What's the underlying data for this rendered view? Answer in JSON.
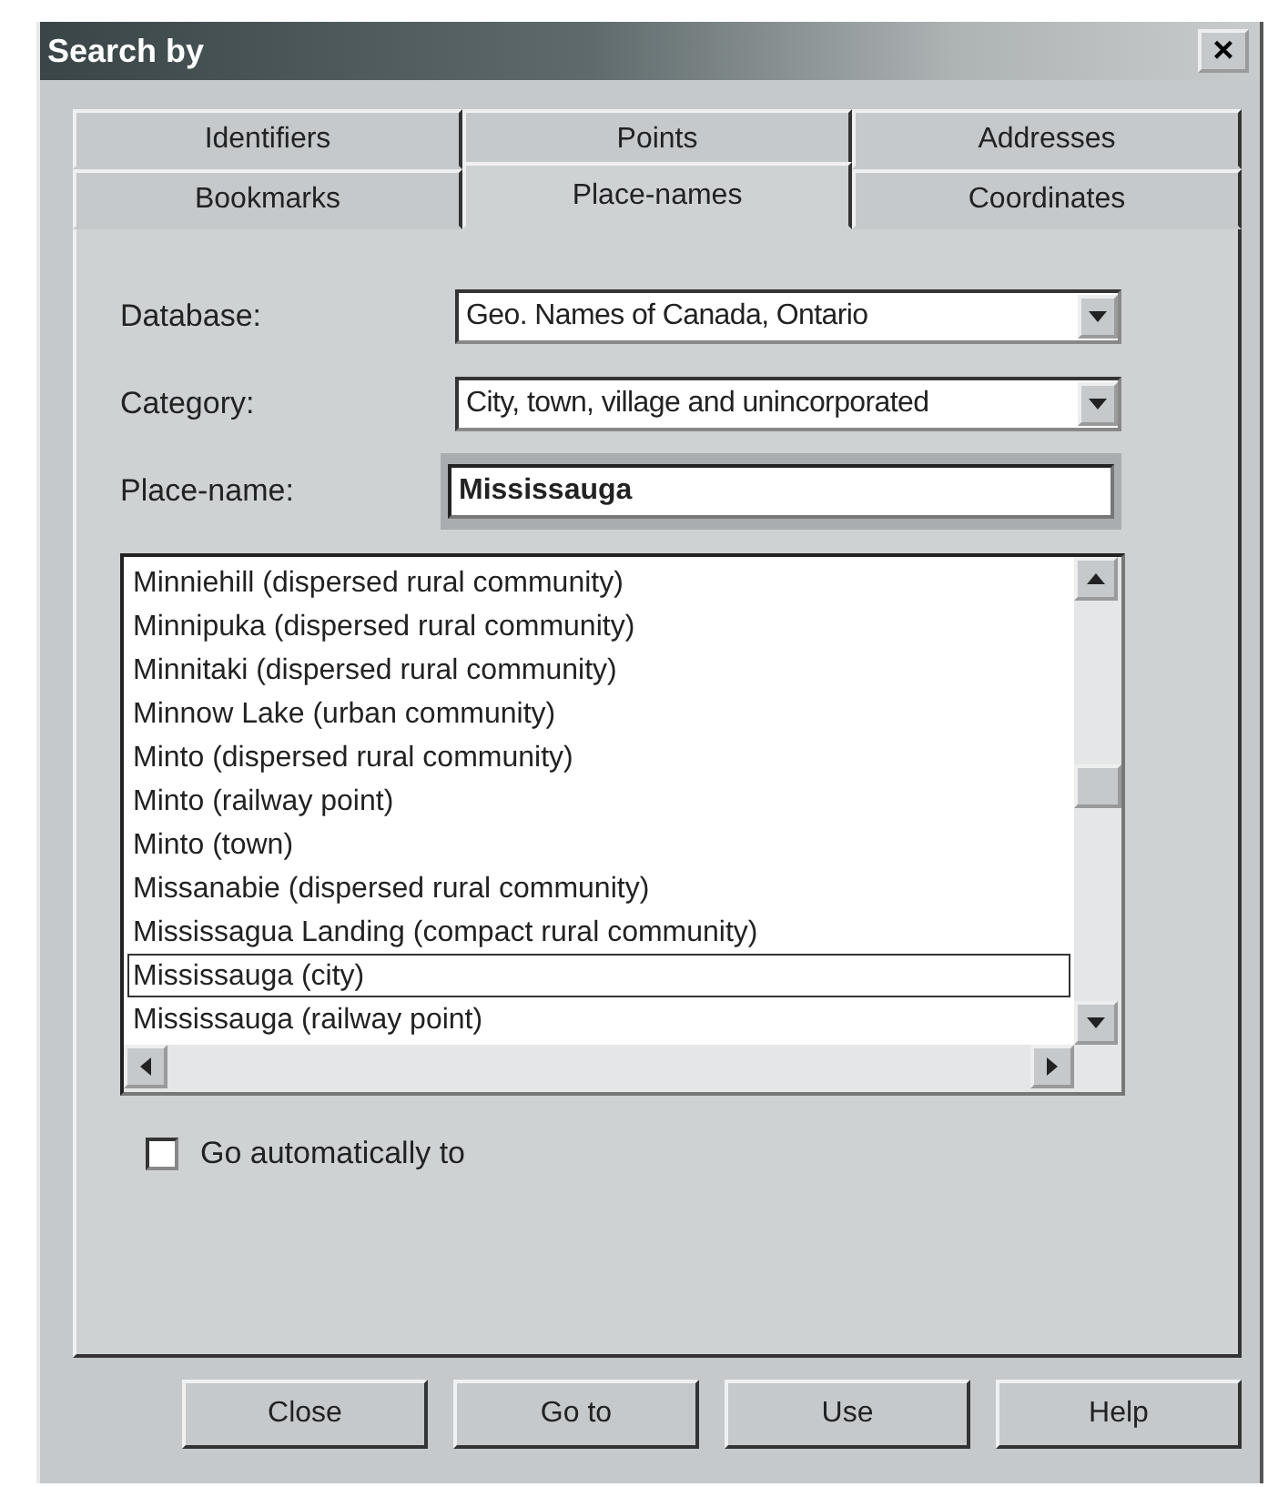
{
  "window": {
    "title": "Search by",
    "close": "×"
  },
  "tab_rows": [
    [
      {
        "label": "Identifiers",
        "selected": false
      },
      {
        "label": "Points",
        "selected": false
      },
      {
        "label": "Addresses",
        "selected": false
      }
    ],
    [
      {
        "label": "Bookmarks",
        "selected": false
      },
      {
        "label": "Place-names",
        "selected": true
      },
      {
        "label": "Coordinates",
        "selected": false
      }
    ]
  ],
  "fields": [
    {
      "label": "Database:",
      "kind": "dropdown",
      "value": "Geo. Names of Canada, Ontario"
    },
    {
      "label": "Category:",
      "kind": "dropdown",
      "value": "City, town, village and unincorporated"
    },
    {
      "label": "Place-name:",
      "kind": "text",
      "value": "Mississauga"
    }
  ],
  "results": [
    {
      "text": "Minniehill (dispersed rural community)",
      "selected": false
    },
    {
      "text": "Minnipuka (dispersed rural community)",
      "selected": false
    },
    {
      "text": "Minnitaki (dispersed rural community)",
      "selected": false
    },
    {
      "text": "Minnow Lake (urban community)",
      "selected": false
    },
    {
      "text": "Minto (dispersed rural community)",
      "selected": false
    },
    {
      "text": "Minto (railway point)",
      "selected": false
    },
    {
      "text": "Minto (town)",
      "selected": false
    },
    {
      "text": "Missanabie (dispersed rural community)",
      "selected": false
    },
    {
      "text": "Mississagua Landing (compact rural community)",
      "selected": false
    },
    {
      "text": "Mississauga (city)",
      "selected": true
    },
    {
      "text": "Mississauga (railway point)",
      "selected": false
    }
  ],
  "go_automatically": {
    "label": "Go automatically to",
    "checked": false
  },
  "buttons": [
    "Close",
    "Go to",
    "Use",
    "Help"
  ]
}
